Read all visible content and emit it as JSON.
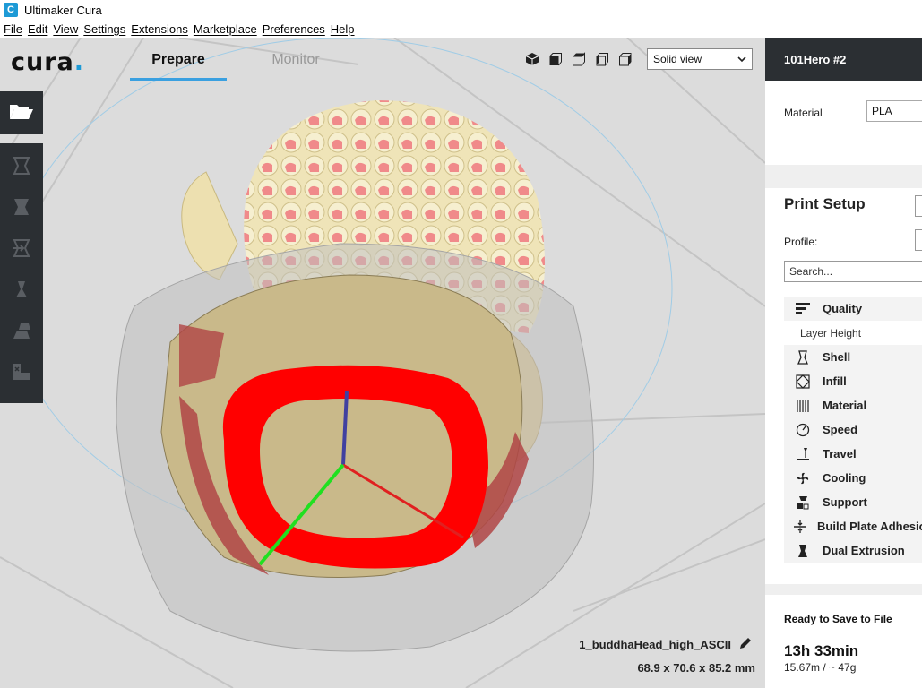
{
  "window": {
    "title": "Ultimaker Cura",
    "app_icon": "cura-app-icon"
  },
  "menubar": {
    "items": [
      {
        "label": "File"
      },
      {
        "label": "Edit"
      },
      {
        "label": "View"
      },
      {
        "label": "Settings"
      },
      {
        "label": "Extensions"
      },
      {
        "label": "Marketplace"
      },
      {
        "label": "Preferences"
      },
      {
        "label": "Help"
      }
    ]
  },
  "header": {
    "logo": "cura",
    "tabs": {
      "prepare": "Prepare",
      "monitor": "Monitor"
    },
    "active_tab": "Prepare",
    "view_buttons": [
      "3d-view-icon",
      "front-view-icon",
      "top-view-icon",
      "left-view-icon",
      "right-view-icon"
    ],
    "view_mode": "Solid view"
  },
  "toolbar": {
    "open_icon": "folder-open-icon",
    "tools": [
      "move-icon",
      "scale-icon",
      "rotate-icon",
      "mirror-icon",
      "per-model-settings-icon",
      "support-blocker-icon"
    ]
  },
  "object": {
    "name": "1_buddhaHead_high_ASCII",
    "dimensions": "68.9 x 70.6 x 85.2 mm"
  },
  "sidebar": {
    "machine_name": "101Hero #2",
    "material_label": "Material",
    "material_value": "PLA",
    "print_setup_title": "Print Setup",
    "profile_label": "Profile:",
    "search_placeholder": "Search...",
    "categories": [
      {
        "label": "Quality",
        "icon": "quality-icon"
      },
      {
        "label": "Layer Height",
        "icon": ""
      },
      {
        "label": "Shell",
        "icon": "shell-icon"
      },
      {
        "label": "Infill",
        "icon": "infill-icon"
      },
      {
        "label": "Material",
        "icon": "material-icon"
      },
      {
        "label": "Speed",
        "icon": "speed-icon"
      },
      {
        "label": "Travel",
        "icon": "travel-icon"
      },
      {
        "label": "Cooling",
        "icon": "cooling-icon"
      },
      {
        "label": "Support",
        "icon": "support-icon"
      },
      {
        "label": "Build Plate Adhesion",
        "icon": "adhesion-icon"
      },
      {
        "label": "Dual Extrusion",
        "icon": "dual-extrusion-icon"
      }
    ]
  },
  "status": {
    "state": "Ready to Save to File",
    "print_time": "13h 33min",
    "usage": "15.67m / ~ 47g"
  },
  "colors": {
    "accent": "#3aa0e0",
    "toolbar_bg": "#2b2f33",
    "model": "#e8dcaa",
    "overhang": "#e05a5a",
    "selection_ring": "#ff0000",
    "axis_x": "#e02020",
    "axis_y": "#20e020",
    "axis_z": "#4040a0"
  }
}
